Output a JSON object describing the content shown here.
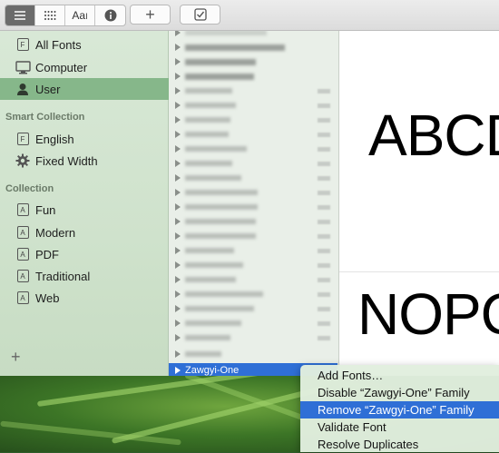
{
  "toolbar": {
    "view_buttons": [
      "list-view",
      "grid-view",
      "sample-view",
      "info-view"
    ],
    "add_label": "+",
    "validate_label": "✓"
  },
  "sidebar": {
    "library_items": [
      {
        "label": "All Fonts",
        "icon": "font-file-icon"
      },
      {
        "label": "Computer",
        "icon": "monitor-icon"
      },
      {
        "label": "User",
        "icon": "user-icon",
        "selected": true
      }
    ],
    "smart_heading": "Smart Collection",
    "smart_items": [
      {
        "label": "English",
        "icon": "font-file-icon"
      },
      {
        "label": "Fixed Width",
        "icon": "gear-icon"
      }
    ],
    "collection_heading": "Collection",
    "collection_items": [
      {
        "label": "Fun"
      },
      {
        "label": "Modern"
      },
      {
        "label": "PDF"
      },
      {
        "label": "Traditional"
      },
      {
        "label": "Web"
      }
    ],
    "add_label": "+"
  },
  "font_list": {
    "selected": "Zawgyi-One"
  },
  "preview": {
    "line1": "ABCD",
    "line2": "NOPQ"
  },
  "context_menu": {
    "items": [
      "Add Fonts…",
      "Disable “Zawgyi-One” Family",
      "Remove “Zawgyi-One” Family",
      "Validate Font",
      "Resolve Duplicates"
    ],
    "highlighted_index": 2
  },
  "colors": {
    "selection_blue": "#2f6fd6",
    "sidebar_selected": "#86b78a"
  }
}
